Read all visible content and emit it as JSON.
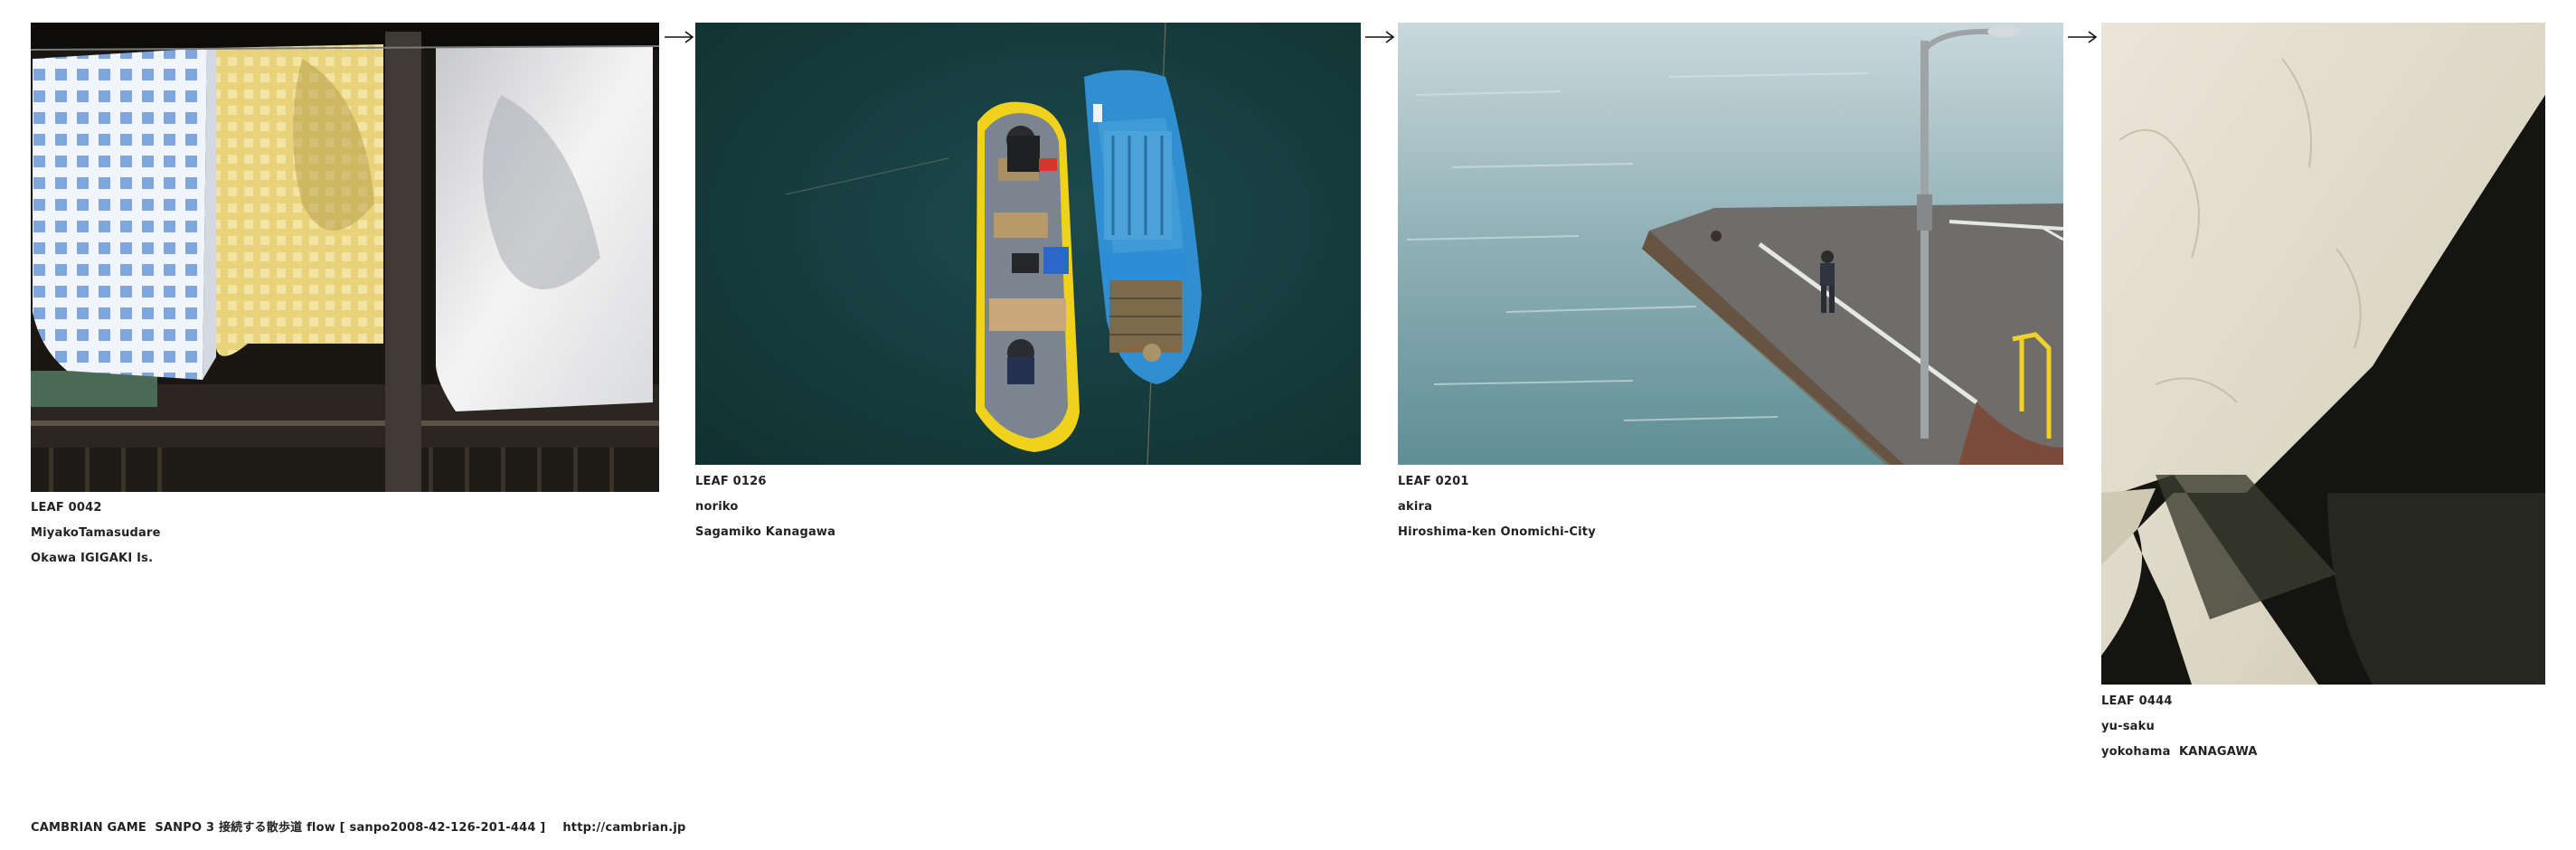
{
  "leaves": [
    {
      "number": "LEAF 0042",
      "name": "MiyakoTamasudare",
      "place": "Okawa IGIGAKI Is.",
      "photo_subject": "towels-hanging-on-line"
    },
    {
      "number": "LEAF 0126",
      "name": "noriko",
      "place": "Sagamiko Kanagawa",
      "photo_subject": "fishing-boats-on-lake"
    },
    {
      "number": "LEAF 0201",
      "name": "akira",
      "place": "Hiroshima-ken Onomichi-City",
      "photo_subject": "boy-on-pier"
    },
    {
      "number": "LEAF 0444",
      "name": "yu-saku",
      "place": "yokohama  KANAGAWA",
      "photo_subject": "shadow-on-wall"
    }
  ],
  "arrow_icon": "arrow-right-icon",
  "footer": {
    "text": "CAMBRIAN GAME  SANPO 3 接続する散歩道 flow [ sanpo2008-42-126-201-444 ]    http://cambrian.jp"
  }
}
